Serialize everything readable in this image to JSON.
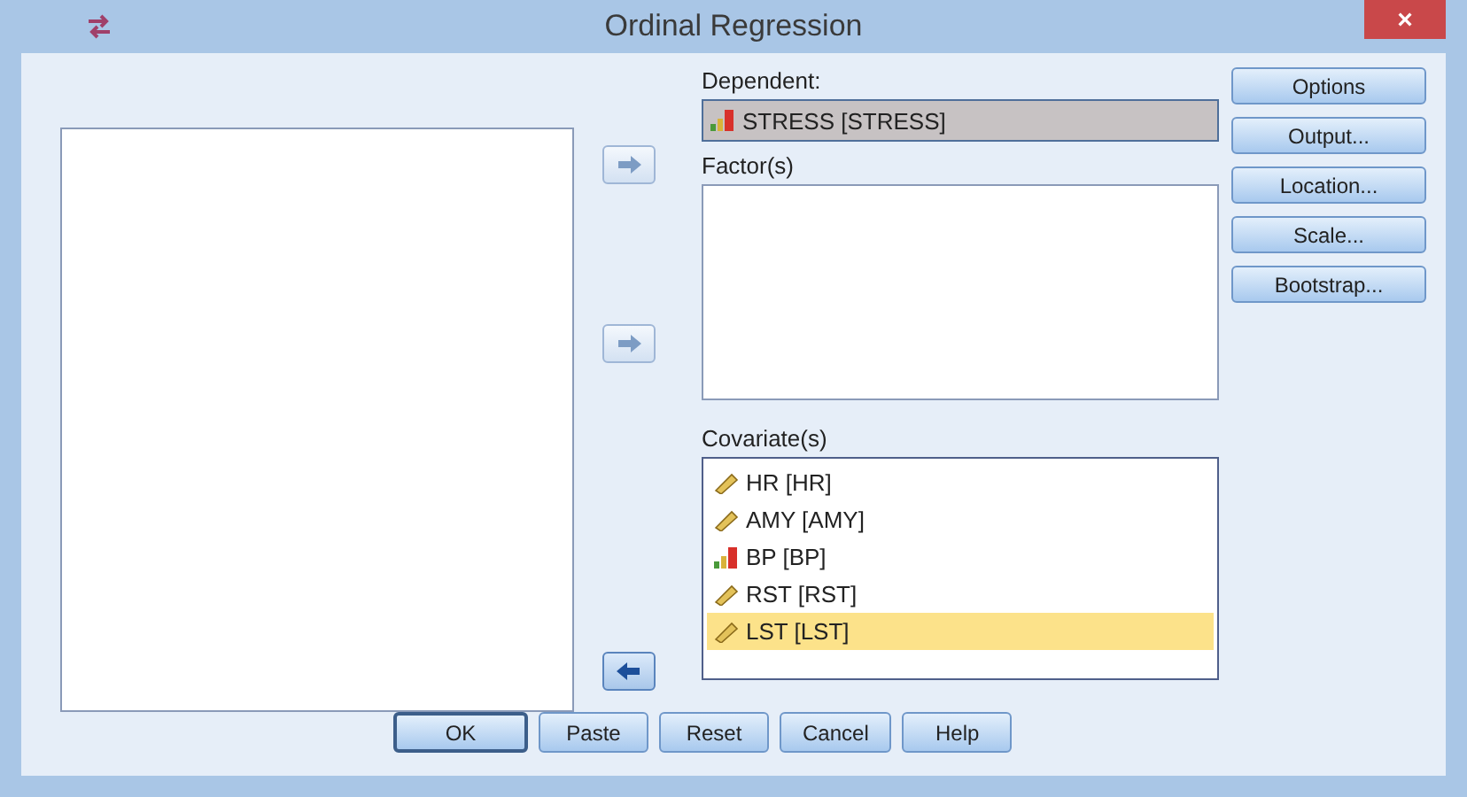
{
  "window": {
    "title": "Ordinal Regression",
    "close": "×"
  },
  "dependent": {
    "label": "Dependent:",
    "variable": {
      "name": "STRESS [STRESS]",
      "kind": "ordinal"
    }
  },
  "factors": {
    "label": "Factor(s)"
  },
  "covariates": {
    "label": "Covariate(s)",
    "items": [
      {
        "name": "HR [HR]",
        "kind": "scale",
        "selected": false
      },
      {
        "name": "AMY [AMY]",
        "kind": "scale",
        "selected": false
      },
      {
        "name": "BP [BP]",
        "kind": "ordinal",
        "selected": false
      },
      {
        "name": "RST [RST]",
        "kind": "scale",
        "selected": false
      },
      {
        "name": "LST [LST]",
        "kind": "scale",
        "selected": true
      }
    ]
  },
  "move_buttons": [
    {
      "kind": "right",
      "enabled": false
    },
    {
      "kind": "right",
      "enabled": false
    },
    {
      "kind": "left",
      "enabled": true
    }
  ],
  "side_buttons": [
    "Options",
    "Output...",
    "Location...",
    "Scale...",
    "Bootstrap..."
  ],
  "bottom_buttons": [
    {
      "label": "OK",
      "default": true
    },
    {
      "label": "Paste",
      "default": false
    },
    {
      "label": "Reset",
      "default": false
    },
    {
      "label": "Cancel",
      "default": false
    },
    {
      "label": "Help",
      "default": false
    }
  ]
}
